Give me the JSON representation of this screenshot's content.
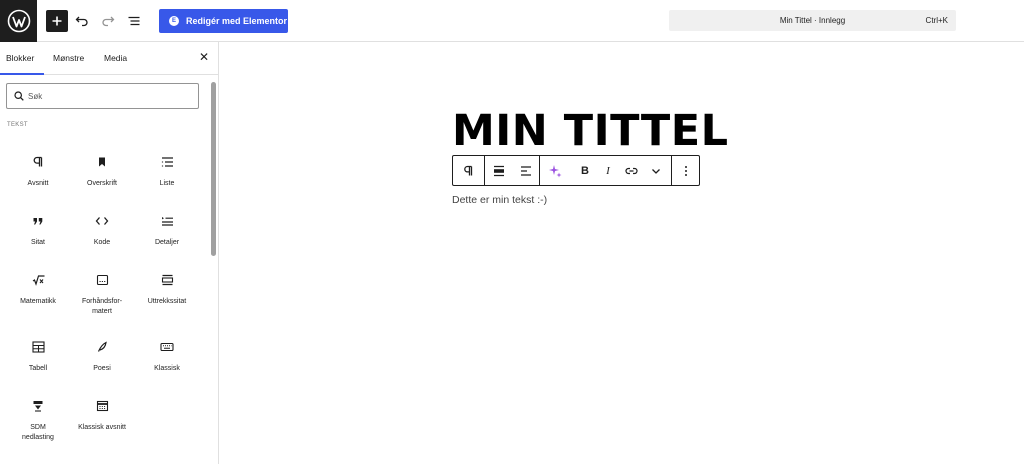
{
  "topbar": {
    "logo_icon": "wordpress-icon",
    "add_icon": "plus-icon",
    "undo_icon": "undo-icon",
    "redo_icon": "redo-icon",
    "listview_icon": "list-view-icon",
    "elementor_label": "Redigér med Elementor",
    "elementor_icon": "elementor-icon",
    "command_title": "Min Tittel · Innlegg",
    "command_shortcut": "Ctrl+K"
  },
  "sidebar": {
    "tabs": [
      {
        "label": "Blokker",
        "active": true
      },
      {
        "label": "Mønstre",
        "active": false
      },
      {
        "label": "Media",
        "active": false
      }
    ],
    "close_icon": "close-icon",
    "search_placeholder": "Søk",
    "category": "TEKST",
    "blocks": [
      {
        "label": "Avsnitt",
        "icon": "paragraph-icon"
      },
      {
        "label": "Overskrift",
        "icon": "heading-icon"
      },
      {
        "label": "Liste",
        "icon": "list-icon"
      },
      {
        "label": "Sitat",
        "icon": "quote-icon"
      },
      {
        "label": "Kode",
        "icon": "code-icon"
      },
      {
        "label": "Detaljer",
        "icon": "details-icon"
      },
      {
        "label": "Matematikk",
        "icon": "math-icon"
      },
      {
        "label": "Forhåndsfor-\nmatert",
        "icon": "preformatted-icon"
      },
      {
        "label": "Uttrekkssitat",
        "icon": "pullquote-icon"
      },
      {
        "label": "Tabell",
        "icon": "table-icon"
      },
      {
        "label": "Poesi",
        "icon": "verse-icon"
      },
      {
        "label": "Klassisk",
        "icon": "classic-icon"
      },
      {
        "label": "SDM\nnedlasting",
        "icon": "download-icon"
      },
      {
        "label": "Klassisk avsnitt",
        "icon": "classic-paragraph-icon"
      }
    ]
  },
  "editor": {
    "title": "MIN TITTEL",
    "paragraph": "Dette er min tekst :-)"
  },
  "colors": {
    "accent": "#3858e9",
    "dark": "#1e1e1e",
    "ai_purple": "#9b51e0"
  }
}
